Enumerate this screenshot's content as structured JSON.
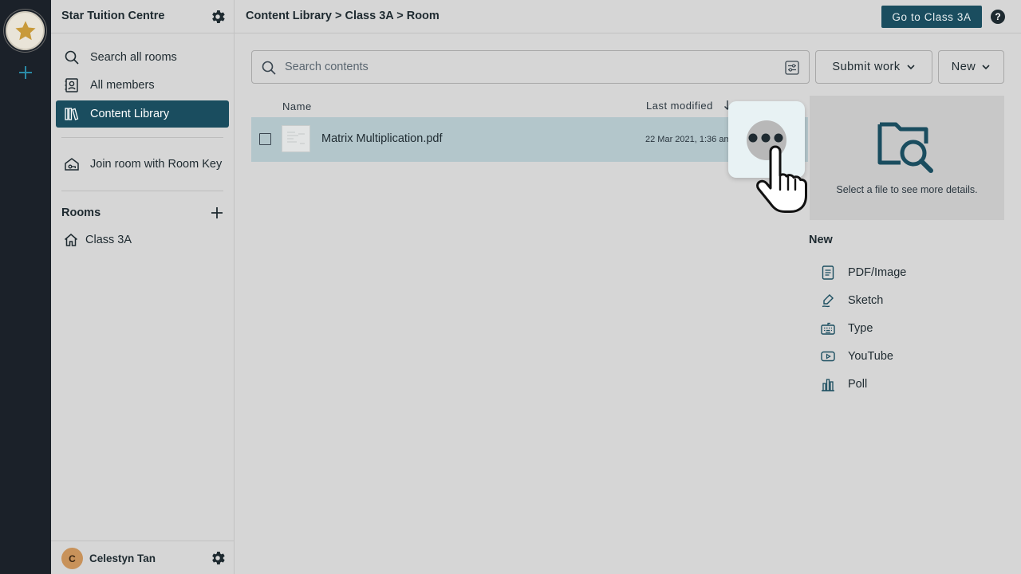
{
  "org": {
    "name": "Star Tuition Centre"
  },
  "sidebar": {
    "items": [
      {
        "label": "Search all rooms",
        "icon": "search-icon"
      },
      {
        "label": "All members",
        "icon": "members-icon"
      },
      {
        "label": "Content Library",
        "icon": "library-icon",
        "active": true
      },
      {
        "label": "Join room with Room Key",
        "icon": "house-key-icon"
      }
    ],
    "rooms_title": "Rooms",
    "rooms": [
      {
        "label": "Class 3A",
        "icon": "home-icon"
      }
    ]
  },
  "user": {
    "initial": "C",
    "name": "Celestyn Tan"
  },
  "header": {
    "breadcrumb": "Content Library > Class 3A > Room",
    "go_button": "Go to Class 3A",
    "help": "?"
  },
  "toolbar": {
    "search_placeholder": "Search contents",
    "submit_work": "Submit work",
    "new": "New"
  },
  "table": {
    "columns": {
      "name": "Name",
      "last_modified": "Last modified"
    },
    "rows": [
      {
        "name": "Matrix Multiplication.pdf",
        "modified": "22 Mar 2021, 1:36 am"
      }
    ]
  },
  "details": {
    "message": "Select a file to see more details."
  },
  "new_panel": {
    "title": "New",
    "items": [
      {
        "label": "PDF/Image",
        "icon": "document-icon"
      },
      {
        "label": "Sketch",
        "icon": "pen-icon"
      },
      {
        "label": "Type",
        "icon": "keyboard-icon"
      },
      {
        "label": "YouTube",
        "icon": "youtube-icon"
      },
      {
        "label": "Poll",
        "icon": "bar-chart-icon"
      }
    ]
  },
  "colors": {
    "accent": "#1a4d5f",
    "rail": "#1b2129",
    "selected_row": "#b3c6cb",
    "star": "#c89a3a"
  }
}
